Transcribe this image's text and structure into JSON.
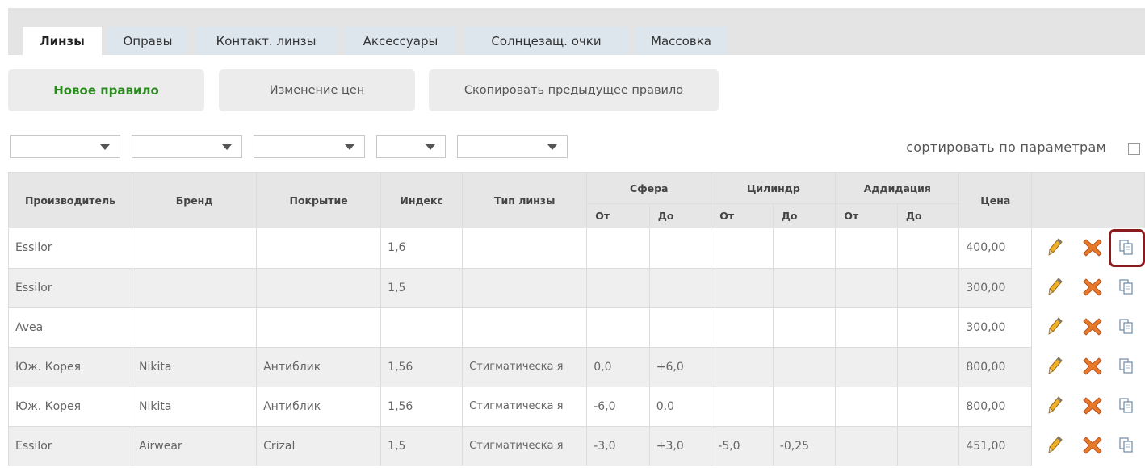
{
  "tabs": [
    {
      "label": "Линзы",
      "active": true
    },
    {
      "label": "Оправы",
      "active": false
    },
    {
      "label": "Контакт. линзы",
      "active": false
    },
    {
      "label": "Аксессуары",
      "active": false
    },
    {
      "label": "Солнцезащ. очки",
      "active": false
    },
    {
      "label": "Массовка",
      "active": false
    }
  ],
  "actions": {
    "new_rule": "Новое правило",
    "change_prices": "Изменение цен",
    "copy_previous": "Скопировать предыдущее правило"
  },
  "filters": {
    "values": [
      "",
      "",
      "",
      "",
      ""
    ]
  },
  "sort": {
    "label": "сортировать по параметрам",
    "checked": false
  },
  "table": {
    "headers": {
      "manufacturer": "Производитель",
      "brand": "Бренд",
      "coating": "Покрытие",
      "index": "Индекс",
      "lens_type": "Тип линзы",
      "sphere": "Сфера",
      "cylinder": "Цилиндр",
      "addition": "Аддидация",
      "price": "Цена",
      "from": "От",
      "to": "До"
    },
    "rows": [
      {
        "manufacturer": "Essilor",
        "brand": "",
        "coating": "",
        "index": "1,6",
        "lens_type": "",
        "sph_from": "",
        "sph_to": "",
        "cyl_from": "",
        "cyl_to": "",
        "add_from": "",
        "add_to": "",
        "price": "400,00"
      },
      {
        "manufacturer": "Essilor",
        "brand": "",
        "coating": "",
        "index": "1,5",
        "lens_type": "",
        "sph_from": "",
        "sph_to": "",
        "cyl_from": "",
        "cyl_to": "",
        "add_from": "",
        "add_to": "",
        "price": "300,00"
      },
      {
        "manufacturer": "Avea",
        "brand": "",
        "coating": "",
        "index": "",
        "lens_type": "",
        "sph_from": "",
        "sph_to": "",
        "cyl_from": "",
        "cyl_to": "",
        "add_from": "",
        "add_to": "",
        "price": "300,00"
      },
      {
        "manufacturer": "Юж. Корея",
        "brand": "Nikita",
        "coating": "Антиблик",
        "index": "1,56",
        "lens_type": "Стигматическа я",
        "sph_from": "0,0",
        "sph_to": "+6,0",
        "cyl_from": "",
        "cyl_to": "",
        "add_from": "",
        "add_to": "",
        "price": "800,00"
      },
      {
        "manufacturer": "Юж. Корея",
        "brand": "Nikita",
        "coating": "Антиблик",
        "index": "1,56",
        "lens_type": "Стигматическа я",
        "sph_from": "-6,0",
        "sph_to": "0,0",
        "cyl_from": "",
        "cyl_to": "",
        "add_from": "",
        "add_to": "",
        "price": "800,00"
      },
      {
        "manufacturer": "Essilor",
        "brand": "Airwear",
        "coating": "Crizal",
        "index": "1,5",
        "lens_type": "Стигматическа я",
        "sph_from": "-3,0",
        "sph_to": "+3,0",
        "cyl_from": "-5,0",
        "cyl_to": "-0,25",
        "add_from": "",
        "add_to": "",
        "price": "451,00"
      }
    ],
    "row_actions": [
      "pencil-icon",
      "delete-x-icon",
      "copy-icon"
    ]
  },
  "colors": {
    "new_rule_text": "#2a8a1e",
    "delete_icon": "#e8782a",
    "highlight_border": "#8c1a1a"
  }
}
